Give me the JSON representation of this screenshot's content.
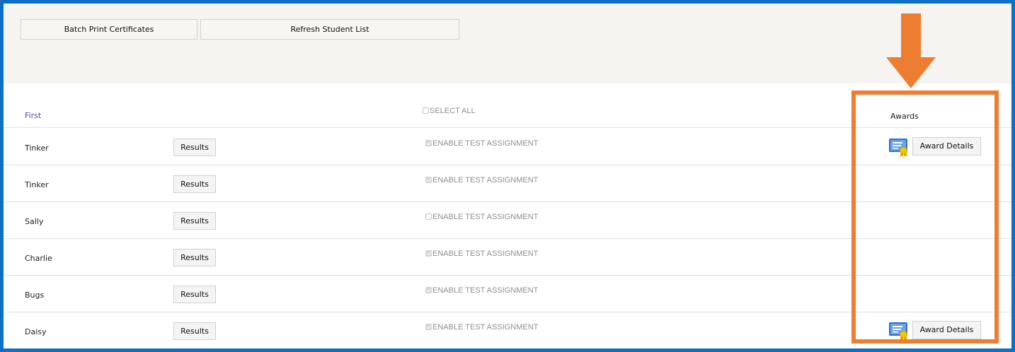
{
  "toolbar": {
    "batch_print_label": "Batch Print Certificates",
    "refresh_label": "Refresh Student List"
  },
  "table": {
    "header": {
      "first": "First",
      "select_all": "SELECT ALL",
      "select_all_checked": false,
      "awards": "Awards"
    },
    "results_label": "Results",
    "enable_label": "ENABLE TEST ASSIGNMENT",
    "award_details_label": "Award Details",
    "rows": [
      {
        "first": "Tinker",
        "enabled": true,
        "has_award": true
      },
      {
        "first": "Tinker",
        "enabled": true,
        "has_award": false
      },
      {
        "first": "Sally",
        "enabled": false,
        "has_award": false
      },
      {
        "first": "Charlie",
        "enabled": true,
        "has_award": false
      },
      {
        "first": "Bugs",
        "enabled": true,
        "has_award": false
      },
      {
        "first": "Daisy",
        "enabled": true,
        "has_award": true
      }
    ]
  },
  "icons": {
    "award": "certificate-award-icon",
    "annotation_arrow": "down-arrow-icon"
  },
  "colors": {
    "frame_border": "#0f6fc6",
    "annotation": "#ed7d31",
    "header_link": "#5a3fd1",
    "toolbar_bg": "#f5f4f1"
  }
}
